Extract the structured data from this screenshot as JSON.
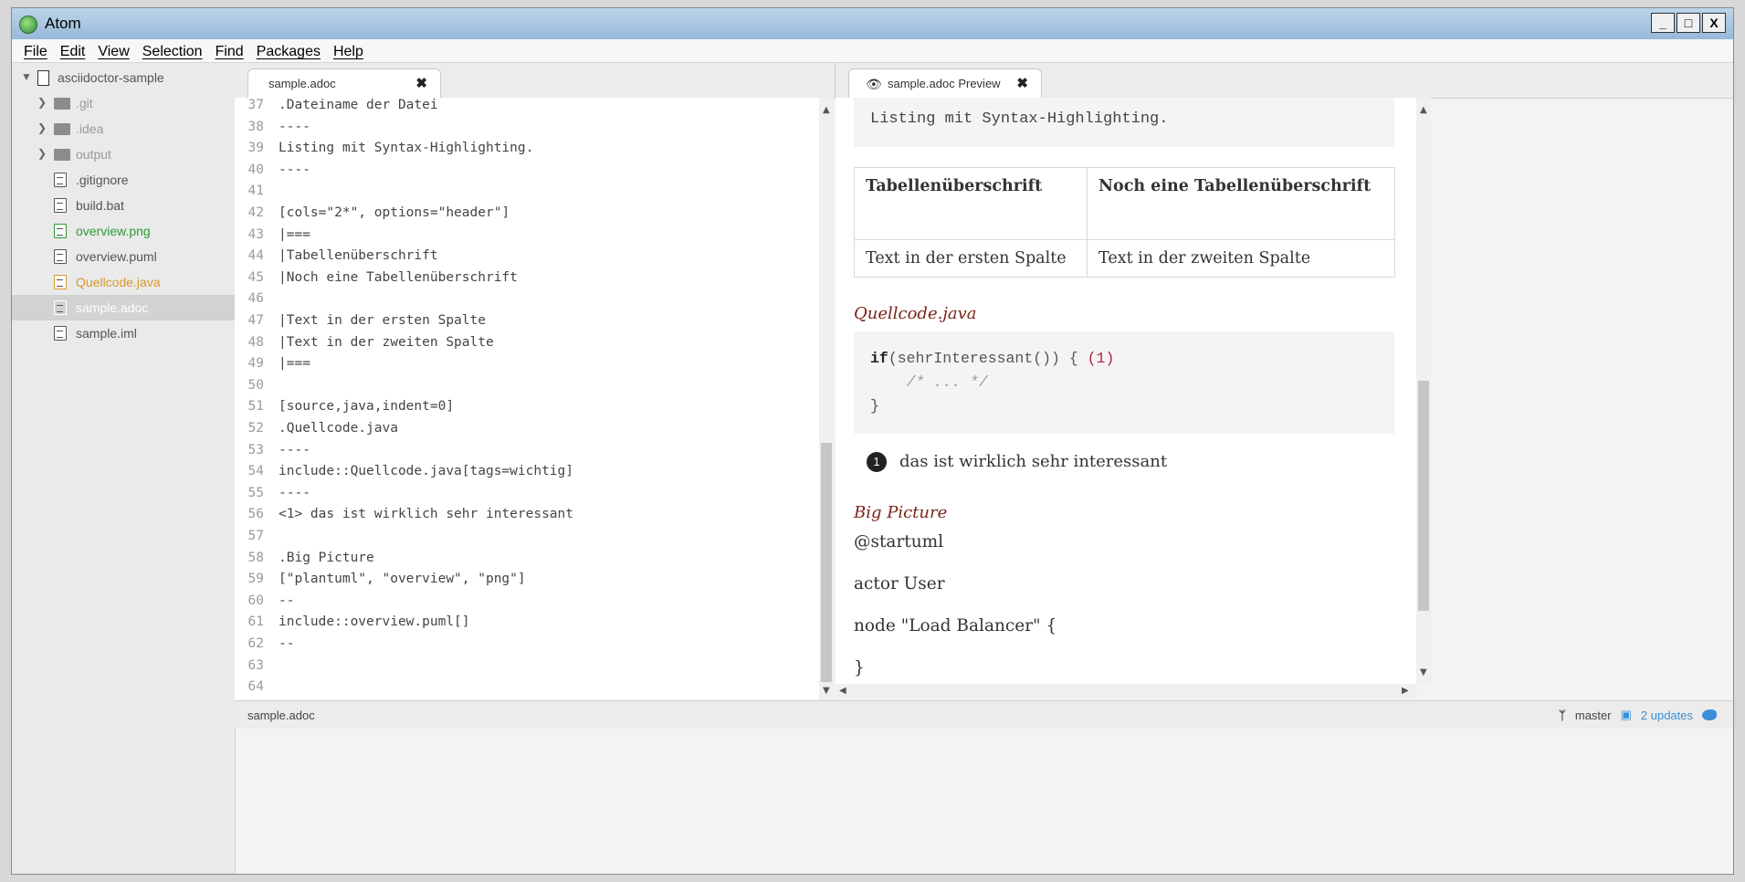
{
  "window": {
    "title": "Atom",
    "controls": [
      "_",
      "□",
      "X"
    ]
  },
  "menu": [
    "File",
    "Edit",
    "View",
    "Selection",
    "Find",
    "Packages",
    "Help"
  ],
  "tree": {
    "root": "asciidoctor-sample",
    "items": [
      {
        "label": ".git",
        "kind": "folder"
      },
      {
        "label": ".idea",
        "kind": "folder"
      },
      {
        "label": "output",
        "kind": "folder"
      },
      {
        "label": ".gitignore",
        "kind": "file"
      },
      {
        "label": "build.bat",
        "kind": "file"
      },
      {
        "label": "overview.png",
        "kind": "image",
        "color": "#2d9b2f"
      },
      {
        "label": "overview.puml",
        "kind": "file"
      },
      {
        "label": "Quellcode.java",
        "kind": "file",
        "color": "#d79a2f"
      },
      {
        "label": "sample.adoc",
        "kind": "file",
        "selected": true
      },
      {
        "label": "sample.iml",
        "kind": "file"
      }
    ]
  },
  "editor": {
    "tab": "sample.adoc",
    "lines": [
      {
        "n": "37",
        "text": ".Dateiname der Datei"
      },
      {
        "n": "38",
        "text": "----"
      },
      {
        "n": "39",
        "text": "Listing mit Syntax-Highlighting."
      },
      {
        "n": "40",
        "text": "----"
      },
      {
        "n": "41",
        "text": ""
      },
      {
        "n": "42",
        "text": "[cols=\"2*\", options=\"header\"]"
      },
      {
        "n": "43",
        "text": "|==="
      },
      {
        "n": "44",
        "text": "|Tabellenüberschrift"
      },
      {
        "n": "45",
        "text": "|Noch eine Tabellenüberschrift"
      },
      {
        "n": "46",
        "text": ""
      },
      {
        "n": "47",
        "text": "|Text in der ersten Spalte"
      },
      {
        "n": "48",
        "text": "|Text in der zweiten Spalte"
      },
      {
        "n": "49",
        "text": "|==="
      },
      {
        "n": "50",
        "text": ""
      },
      {
        "n": "51",
        "text": "[source,java,indent=0]"
      },
      {
        "n": "52",
        "text": ".Quellcode.java"
      },
      {
        "n": "53",
        "text": "----"
      },
      {
        "n": "54",
        "text": "include::Quellcode.java[tags=wichtig]"
      },
      {
        "n": "55",
        "text": "----"
      },
      {
        "n": "56",
        "text": "<1> das ist wirklich sehr interessant"
      },
      {
        "n": "57",
        "text": ""
      },
      {
        "n": "58",
        "text": ".Big Picture"
      },
      {
        "n": "59",
        "text": "[\"plantuml\", \"overview\", \"png\"]"
      },
      {
        "n": "60",
        "text": "--"
      },
      {
        "n": "61",
        "text": "include::overview.puml[]"
      },
      {
        "n": "62",
        "text": "--"
      },
      {
        "n": "63",
        "text": ""
      },
      {
        "n": "64",
        "text": ""
      }
    ]
  },
  "preview": {
    "tab": "sample.adoc Preview",
    "listing": "Listing mit Syntax-Highlighting.",
    "table": {
      "headers": [
        "Tabellenüberschrift",
        "Noch eine Tabellenüberschrift"
      ],
      "row": [
        "Text in der ersten Spalte",
        "Text in der zweiten Spalte"
      ]
    },
    "code_title": "Quellcode.java",
    "code": {
      "line1_kw": "if",
      "line1_rest": "(sehrInteressant()) { ",
      "line1_callout": "(1)",
      "line2": "    /* ... */",
      "line3": "}"
    },
    "callout": {
      "number": "1",
      "text": "das ist wirklich sehr interessant"
    },
    "image_title": "Big Picture",
    "paragraphs": [
      "@startuml",
      "actor User",
      "node \"Load Balancer\" {",
      "}"
    ]
  },
  "status": {
    "file": "sample.adoc",
    "branch": "master",
    "updates": "2 updates"
  },
  "colors": {
    "accent": "#3c8fd6",
    "title_red": "#7a2518",
    "tree_selected": "#d2d2d2"
  }
}
